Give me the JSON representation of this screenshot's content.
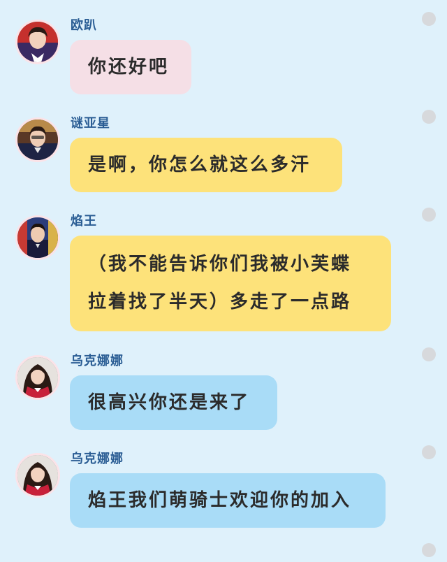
{
  "messages": [
    {
      "sender": "欧趴",
      "lines": [
        "你还好吧"
      ],
      "bubble_color": "#f5dfe6"
    },
    {
      "sender": "谜亚星",
      "lines": [
        "是啊，你怎么就这么多汗"
      ],
      "bubble_color": "#fde27a"
    },
    {
      "sender": "焰王",
      "lines": [
        "（我不能告诉你们我被小芙蝶",
        "拉着找了半天）多走了一点路"
      ],
      "bubble_color": "#fde27a"
    },
    {
      "sender": "乌克娜娜",
      "lines": [
        "很高兴你还是来了"
      ],
      "bubble_color": "#a9dcf7"
    },
    {
      "sender": "乌克娜娜",
      "lines": [
        "焰王我们萌骑士欢迎你的加入"
      ],
      "bubble_color": "#a9dcf7"
    }
  ],
  "colors": {
    "background": "#dff1fb",
    "sender_name": "#2a5d94",
    "pink_bubble": "#f5dfe6",
    "yellow_bubble": "#fde27a",
    "blue_bubble": "#a9dcf7",
    "scroll_dots": "#d7d9dc"
  }
}
